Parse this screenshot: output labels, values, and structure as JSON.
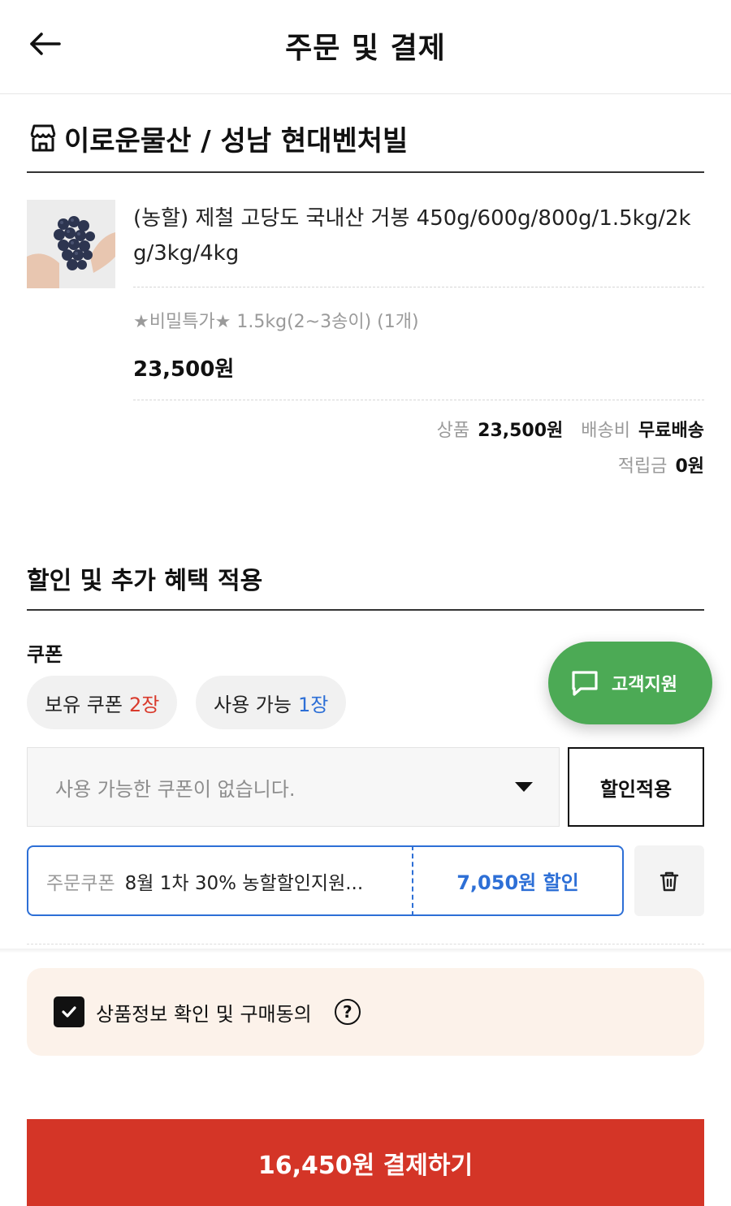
{
  "header": {
    "title": "주문 및 결제"
  },
  "store": {
    "name": "이로운물산 / 성남 현대벤처빌"
  },
  "product": {
    "name": "(농할) 제철 고당도 국내산 거봉 450g/600g/800g/1.5kg/2kg/3kg/4kg",
    "option": "★비밀특가★ 1.5kg(2~3송이) (1개)",
    "price": "23,500원"
  },
  "summary": {
    "product_label": "상품",
    "product_value": "23,500원",
    "shipping_label": "배송비",
    "shipping_value": "무료배송",
    "points_label": "적립금",
    "points_value": "0원"
  },
  "discount": {
    "section_title": "할인 및 추가 혜택 적용",
    "coupon_label": "쿠폰",
    "owned_label": "보유 쿠폰",
    "owned_count": "2장",
    "usable_label": "사용 가능",
    "usable_count": "1장",
    "select_text": "사용 가능한 쿠폰이 없습니다.",
    "apply_label": "할인적용",
    "applied_type": "주문쿠폰",
    "applied_name": "8월 1차 30% 농할할인지원...",
    "applied_amount": "7,050원 할인"
  },
  "support": {
    "label": "고객지원"
  },
  "agreement": {
    "text": "상품정보 확인 및 구매동의",
    "help": "?",
    "checked": true
  },
  "pay": {
    "label": "16,450원 결제하기"
  },
  "colors": {
    "accent_red": "#d43527",
    "accent_blue": "#2d6fd6",
    "support_green": "#4caa55",
    "agree_bg": "#fcf2ea"
  }
}
